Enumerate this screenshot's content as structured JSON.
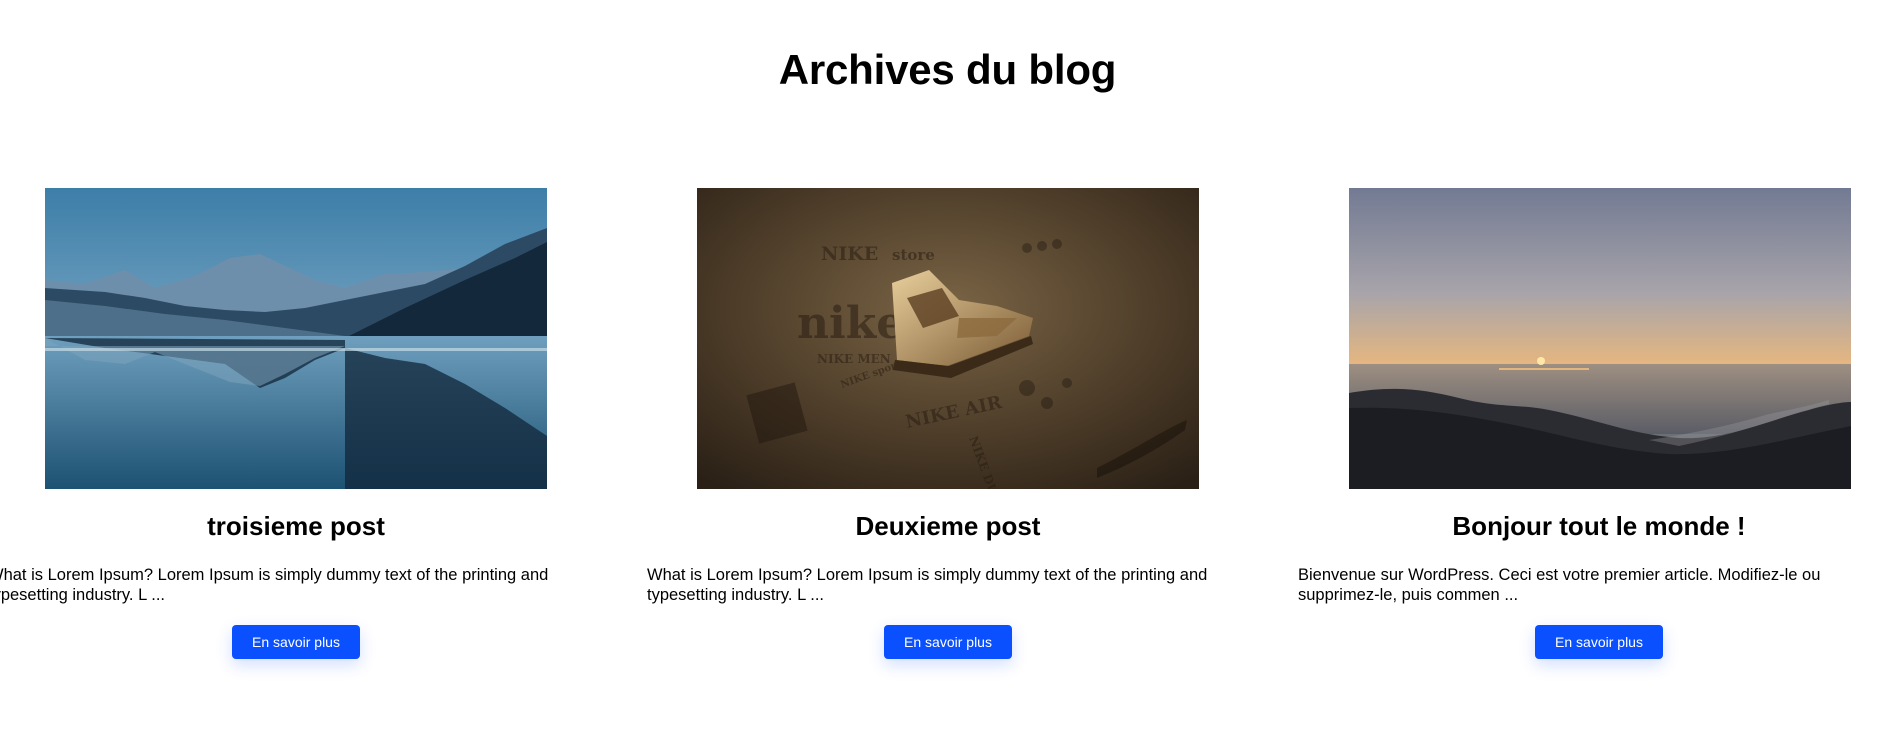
{
  "page": {
    "title": "Archives du blog"
  },
  "posts": [
    {
      "title": "troisieme post",
      "excerpt": "What is Lorem Ipsum? Lorem Ipsum is simply dummy text of the printing and typesetting industry. L ...",
      "button_label": "En savoir plus",
      "image": "mountain-lake-image"
    },
    {
      "title": "Deuxieme post",
      "excerpt": "What is Lorem Ipsum? Lorem Ipsum is simply dummy text of the printing and typesetting industry. L ...",
      "button_label": "En savoir plus",
      "image": "nike-shoe-collage-image",
      "image_text": [
        "NIKE",
        "store",
        "nike",
        "NIKE MEN",
        "NIKE AIR",
        "NIKE DUNK",
        "NIKE sportswear"
      ]
    },
    {
      "title": "Bonjour tout le monde !",
      "excerpt": "Bienvenue sur WordPress. Ceci est votre premier article. Modifiez-le ou supprimez-le, puis commen ...",
      "button_label": "En savoir plus",
      "image": "sunset-coast-image"
    }
  ],
  "colors": {
    "accent": "#0a50ff",
    "background": "#ffffff",
    "text": "#000000"
  }
}
